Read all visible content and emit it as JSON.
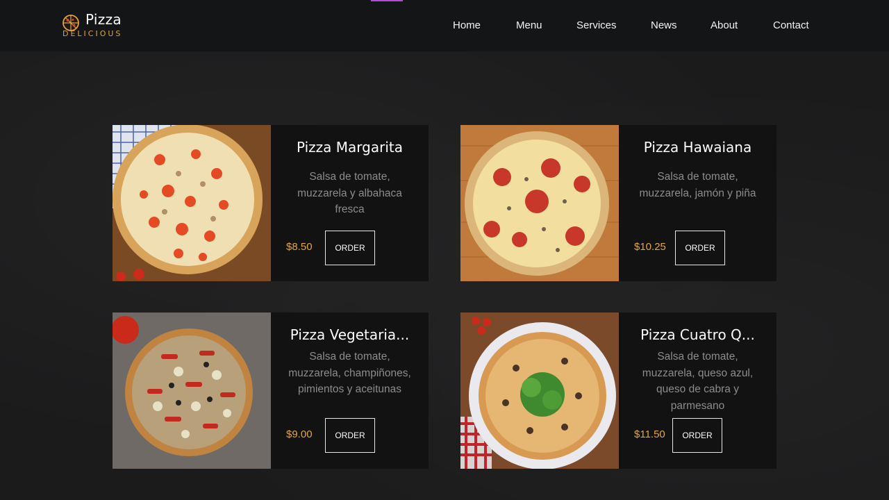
{
  "brand": {
    "title": "Pizza",
    "subtitle": "DELICIOUS"
  },
  "nav": [
    "Home",
    "Menu",
    "Services",
    "News",
    "About",
    "Contact"
  ],
  "menu": [
    {
      "name": "Pizza Margarita",
      "description": "Salsa de tomate, muzzarela y albahaca fresca",
      "price": "$8.50",
      "action": "ORDER"
    },
    {
      "name": "Pizza Hawaiana",
      "description": "Salsa de tomate, muzzarela, jamón y piña",
      "price": "$10.25",
      "action": "ORDER"
    },
    {
      "name": "Pizza Vegetaria...",
      "description": "Salsa de tomate, muzzarela, champiñones, pimientos y aceitunas",
      "price": "$9.00",
      "action": "ORDER"
    },
    {
      "name": "Pizza Cuatro Q...",
      "description": "Salsa de tomate, muzzarela, queso azul, queso de cabra y parmesano",
      "price": "$11.50",
      "action": "ORDER"
    }
  ],
  "colors": {
    "accent": "#e1a73b",
    "header": "#141516",
    "card": "#121212",
    "nav_highlight": "#b04ad8"
  },
  "icons": {
    "logo": "pizza-logo-icon"
  }
}
